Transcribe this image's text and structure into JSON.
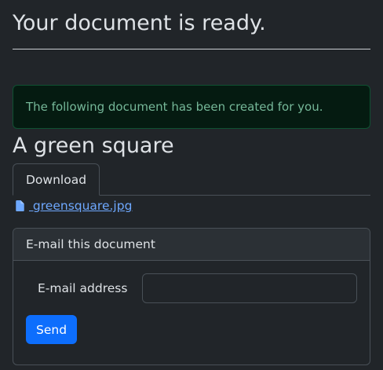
{
  "page": {
    "title": "Your document is ready."
  },
  "alert": {
    "text": "The following document has been created for you."
  },
  "document": {
    "title": "A green square",
    "tabs": [
      {
        "label": "Download",
        "active": true
      }
    ],
    "file": {
      "icon": "file-icon",
      "name": " greensquare.jpg"
    }
  },
  "email_card": {
    "header": "E-mail this document",
    "field_label": "E-mail address",
    "field_value": "",
    "send_label": "Send"
  },
  "colors": {
    "background": "#212529",
    "alert_text": "#75b798",
    "link": "#6ea8fe",
    "primary_button": "#0d6efd"
  }
}
